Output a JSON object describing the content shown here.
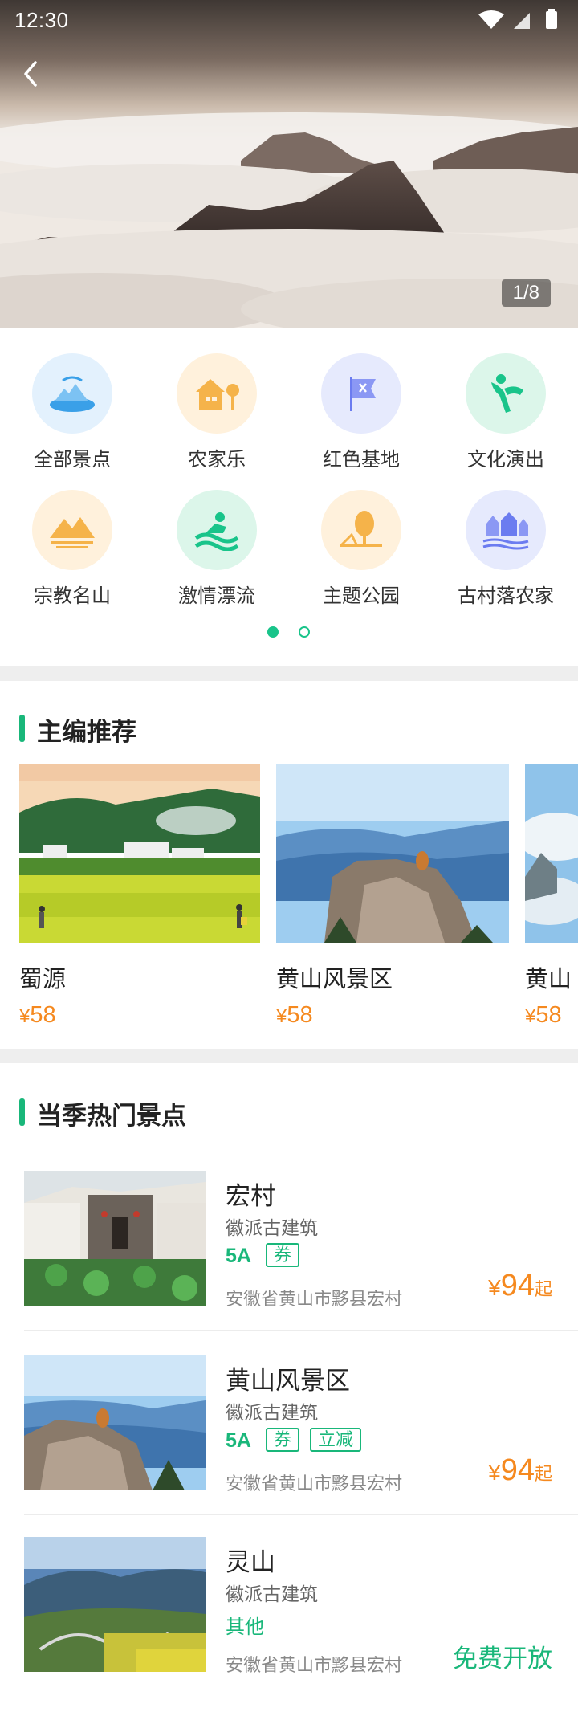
{
  "status_bar": {
    "time": "12:30"
  },
  "hero": {
    "page_indicator": "1/8"
  },
  "categories": [
    {
      "label": "全部景点",
      "icon": "mountain-lake-icon",
      "bg": "#e3f1fd",
      "fg": "#3aa0e8"
    },
    {
      "label": "农家乐",
      "icon": "farmhouse-icon",
      "bg": "#fff1dc",
      "fg": "#f5b34a"
    },
    {
      "label": "红色基地",
      "icon": "red-flag-icon",
      "bg": "#e6eafd",
      "fg": "#6b7cf0"
    },
    {
      "label": "文化演出",
      "icon": "performance-icon",
      "bg": "#dcf6ea",
      "fg": "#19c48a"
    },
    {
      "label": "宗教名山",
      "icon": "sacred-mountain-icon",
      "bg": "#fff1dc",
      "fg": "#f5b34a"
    },
    {
      "label": "激情漂流",
      "icon": "rafting-icon",
      "bg": "#dcf6ea",
      "fg": "#19c48a"
    },
    {
      "label": "主题公园",
      "icon": "theme-park-icon",
      "bg": "#fff1dc",
      "fg": "#f5b34a"
    },
    {
      "label": "古村落农家",
      "icon": "ancient-village-icon",
      "bg": "#e6eafd",
      "fg": "#6b7cf0"
    }
  ],
  "recommend": {
    "title": "主编推荐",
    "cards": [
      {
        "name": "蜀源",
        "currency": "¥",
        "price": "58"
      },
      {
        "name": "黄山风景区",
        "currency": "¥",
        "price": "58"
      },
      {
        "name": "黄山",
        "currency": "¥",
        "price": "58"
      }
    ]
  },
  "hot": {
    "title": "当季热门景点",
    "items": [
      {
        "name": "宏村",
        "subtitle": "徽派古建筑",
        "level": "5A",
        "tags": [
          "券"
        ],
        "address": "安徽省黄山市黟县宏村",
        "currency": "¥",
        "price": "94",
        "price_suffix": "起"
      },
      {
        "name": "黄山风景区",
        "subtitle": "徽派古建筑",
        "level": "5A",
        "tags": [
          "券",
          "立减"
        ],
        "address": "安徽省黄山市黟县宏村",
        "currency": "¥",
        "price": "94",
        "price_suffix": "起"
      },
      {
        "name": "灵山",
        "subtitle": "徽派古建筑",
        "level": "其他",
        "tags": [],
        "address": "安徽省黄山市黟县宏村",
        "free_label": "免费开放"
      }
    ]
  },
  "colors": {
    "accent_green": "#19b77a",
    "price_orange": "#f5891f",
    "divider": "#eeeeee"
  }
}
